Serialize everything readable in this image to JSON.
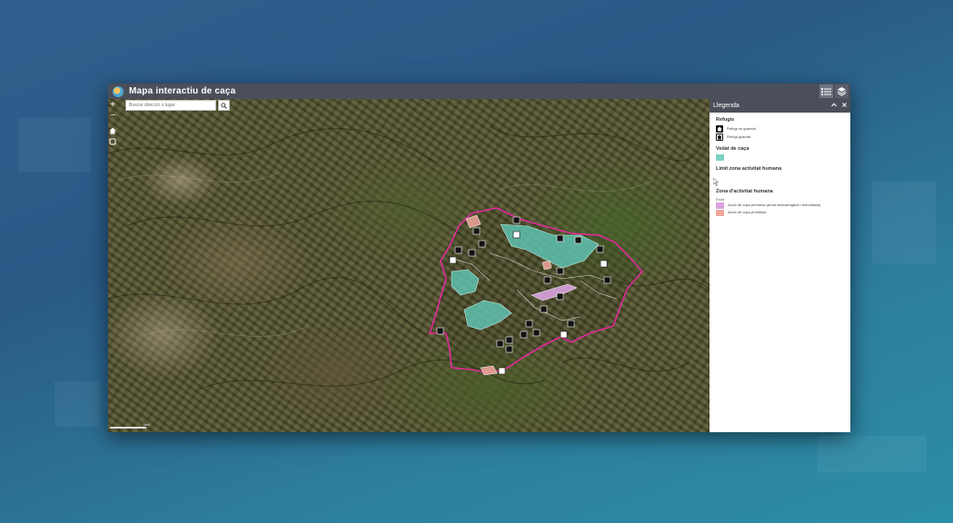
{
  "app": {
    "title": "Mapa interactiu de caça",
    "colors": {
      "header": "#4b4f5a",
      "panel": "#ffffff",
      "accent_boundary": "#e52a9c",
      "hunting_zone": "#5fc6b4"
    }
  },
  "toolbar": {
    "legend_button_icon": "legend-list-icon",
    "layers_button_icon": "layers-icon"
  },
  "map_controls": {
    "zoom_in": "+",
    "zoom_out": "−",
    "home_icon": "home-icon",
    "locate_icon": "locate-icon"
  },
  "search": {
    "placeholder": "Buscar direcció o lugar",
    "button_icon": "search-icon"
  },
  "scale": {
    "label": "1km"
  },
  "legend": {
    "title": "Llegenda",
    "collapse_icon": "chevron-up-icon",
    "close_icon": "close-icon",
    "sections": {
      "refugis": {
        "title": "Refugis",
        "items": [
          "Refugi no guardat",
          "Refugi guardat"
        ]
      },
      "vedat": {
        "title": "Vedat de caça"
      },
      "limit": {
        "title": "Límit zona activitat humana"
      },
      "zona": {
        "title": "Zona d'activitat humana",
        "subtitle": "Estat",
        "items": [
          {
            "label": "Acció de caça permesa (arma descarregada i enfundada)",
            "color": "#d9a3e0"
          },
          {
            "label": "Acció de caça prohibida",
            "color": "#f2a79b"
          }
        ]
      }
    }
  }
}
